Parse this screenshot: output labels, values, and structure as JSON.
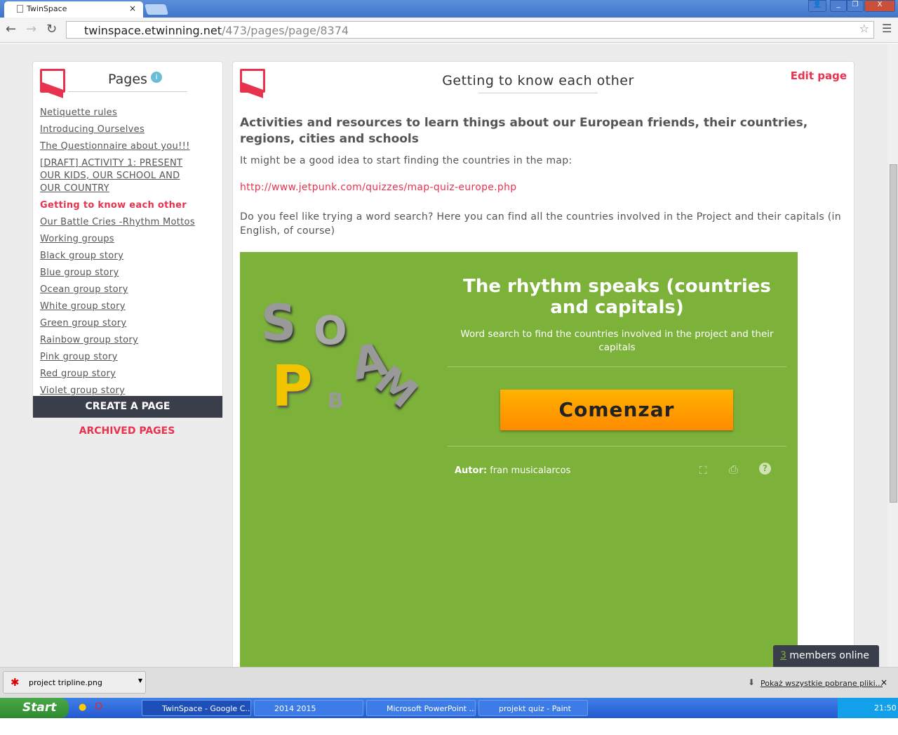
{
  "browser": {
    "tab_title": "TwinSpace",
    "url_host": "twinspace.etwinning.net",
    "url_path": "/473/pages/page/8374"
  },
  "sidebar": {
    "title": "Pages",
    "items": [
      {
        "label": "Netiquette rules",
        "active": false
      },
      {
        "label": "Introducing Ourselves",
        "active": false
      },
      {
        "label": "The Questionnaire about you!!!",
        "active": false
      },
      {
        "label": "[DRAFT] ACTIVITY 1: PRESENT OUR KIDS, OUR SCHOOL AND OUR COUNTRY",
        "active": false
      },
      {
        "label": "Getting to know each other",
        "active": true
      },
      {
        "label": "Our Battle Cries -Rhythm Mottos",
        "active": false
      },
      {
        "label": "Working groups",
        "active": false
      },
      {
        "label": "Black group story",
        "active": false
      },
      {
        "label": "Blue group story",
        "active": false
      },
      {
        "label": "Ocean group story",
        "active": false
      },
      {
        "label": "White group story",
        "active": false
      },
      {
        "label": "Green group story",
        "active": false
      },
      {
        "label": "Rainbow group story",
        "active": false
      },
      {
        "label": "Pink group story",
        "active": false
      },
      {
        "label": "Red group story",
        "active": false
      },
      {
        "label": "Violet group story",
        "active": false
      }
    ],
    "create_label": "CREATE A PAGE",
    "archived_label": "ARCHIVED PAGES"
  },
  "main": {
    "title": "Getting to know each other",
    "edit_label": "Edit page",
    "heading": "Activities and resources to learn things about our European friends, their countries, regions, cities and schools",
    "p1": "It might be a good idea to start finding the countries in the map:",
    "link": "http://www.jetpunk.com/quizzes/map-quiz-europe.php",
    "p2": "Do you feel like trying a word search? Here you can find all the countries involved in the Project and their capitals (in English, of course)"
  },
  "embed": {
    "logo_letters": "SOPAMB",
    "title": "The rhythm speaks (countries and capitals)",
    "subtitle": "Word search to find the countries involved in the project and their capitals",
    "button": "Comenzar",
    "author_label": "Autor:",
    "author": "fran musicalarcos",
    "color": "#7cb13a"
  },
  "online": {
    "count": "3",
    "label": "members online"
  },
  "download": {
    "file": "project tripline.png",
    "show_all": "Pokaż wszystkie pobrane pliki..."
  },
  "taskbar": {
    "start": "Start",
    "tasks": [
      "TwinSpace - Google C...",
      "2014 2015",
      "Microsoft PowerPoint ...",
      "projekt quiz - Paint"
    ],
    "clock": "21:50"
  }
}
